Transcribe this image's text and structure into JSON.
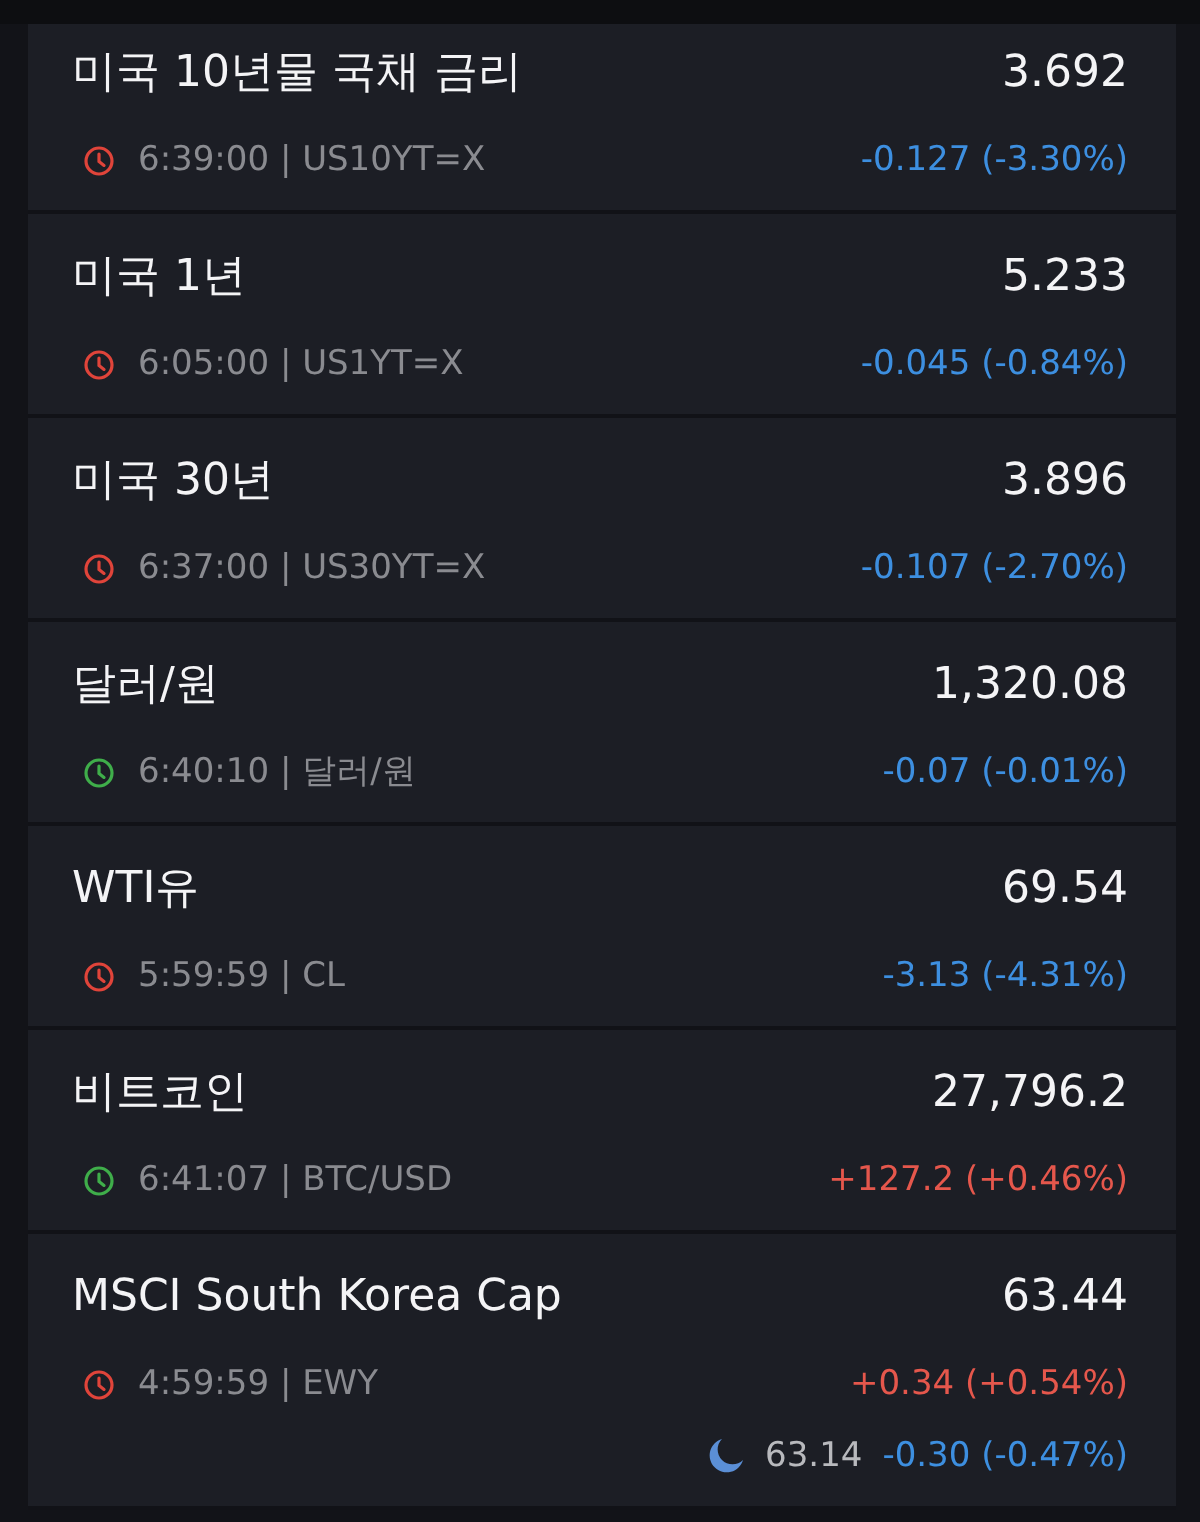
{
  "quotes": [
    {
      "name": "미국 10년물 국채 금리",
      "price": "3.692",
      "time_symbol": "6:39:00 | US10YT=X",
      "color": "#e0443a",
      "change": "-0.127 (-3.30%)",
      "rising": false
    },
    {
      "name": "미국 1년",
      "price": "5.233",
      "time_symbol": "6:05:00 | US1YT=X",
      "color": "#e0443a",
      "change": "-0.045 (-0.84%)",
      "rising": false
    },
    {
      "name": "미국 30년",
      "price": "3.896",
      "time_symbol": "6:37:00 | US30YT=X",
      "color": "#e0443a",
      "change": "-0.107 (-2.70%)",
      "rising": false
    },
    {
      "name": "달러/원",
      "price": "1,320.08",
      "time_symbol": "6:40:10 | 달러/원",
      "color": "#3fae4a",
      "change": "-0.07 (-0.01%)",
      "rising": false
    },
    {
      "name": "WTI유",
      "price": "69.54",
      "time_symbol": "5:59:59 | CL",
      "color": "#e0443a",
      "change": "-3.13 (-4.31%)",
      "rising": false
    },
    {
      "name": "비트코인",
      "price": "27,796.2",
      "time_symbol": "6:41:07 | BTC/USD",
      "color": "#3fae4a",
      "change": "+127.2 (+0.46%)",
      "rising": true
    },
    {
      "name": "MSCI South Korea Cap",
      "price": "63.44",
      "time_symbol": "4:59:59 | EWY",
      "color": "#e0443a",
      "change": "+0.34 (+0.54%)",
      "rising": true,
      "after_hours": {
        "price": "63.14",
        "change": "-0.30 (-0.47%)",
        "rising": false
      }
    }
  ]
}
